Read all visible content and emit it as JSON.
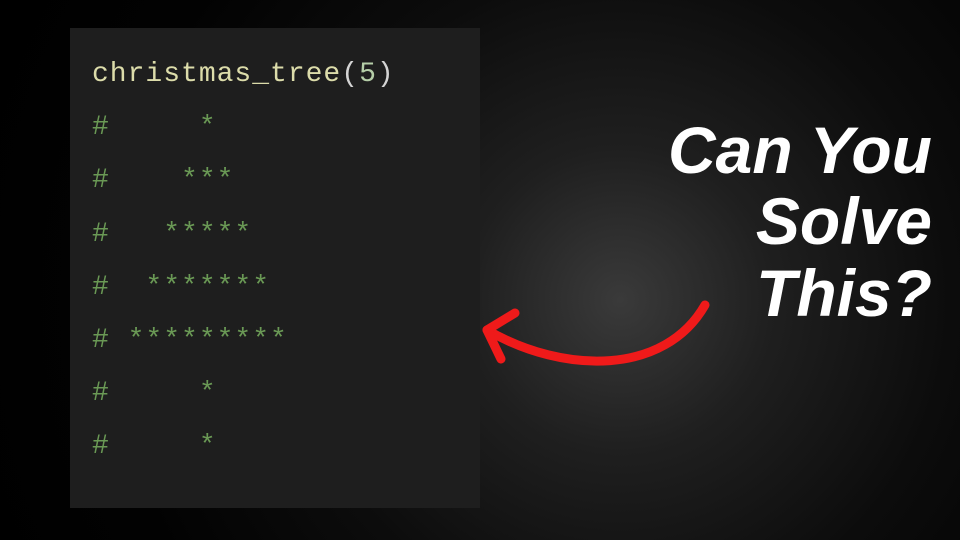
{
  "code": {
    "func_name": "christmas_tree",
    "open_paren": "(",
    "arg": "5",
    "close_paren": ")",
    "lines": [
      "#     *",
      "#    ***",
      "#   *****",
      "#  *******",
      "# *********",
      "#     *",
      "#     *"
    ]
  },
  "headline": {
    "line1": "Can You",
    "line2": "Solve",
    "line3": "This?"
  },
  "colors": {
    "arrow": "#ef1a1a"
  }
}
